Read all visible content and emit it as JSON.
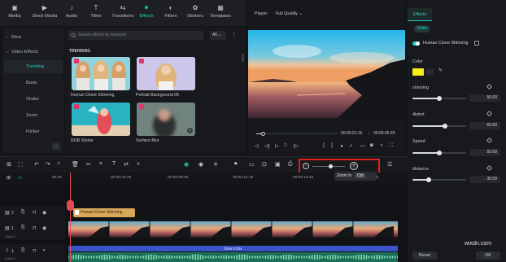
{
  "top_tabs": [
    {
      "label": "Media",
      "icon": "media-icon"
    },
    {
      "label": "Stock Media",
      "icon": "stock-media-icon"
    },
    {
      "label": "Audio",
      "icon": "audio-icon"
    },
    {
      "label": "Titles",
      "icon": "titles-icon"
    },
    {
      "label": "Transitions",
      "icon": "transitions-icon"
    },
    {
      "label": "Effects",
      "icon": "effects-icon",
      "active": true
    },
    {
      "label": "Filters",
      "icon": "filters-icon"
    },
    {
      "label": "Stickers",
      "icon": "stickers-icon"
    },
    {
      "label": "Templates",
      "icon": "templates-icon"
    }
  ],
  "sidebar": {
    "items": [
      {
        "label": "Mine"
      },
      {
        "label": "Video Effects"
      },
      {
        "label": "Trending"
      },
      {
        "label": "Basic"
      },
      {
        "label": "Shake"
      },
      {
        "label": "Zoom"
      },
      {
        "label": "Flicker"
      }
    ]
  },
  "library": {
    "search_placeholder": "Search effects by keyword",
    "filter": "All",
    "section": "TRENDING",
    "cards": [
      {
        "label": "Human Clone Shinning"
      },
      {
        "label": "Portrait Background 05"
      },
      {
        "label": "RGB Stroke"
      },
      {
        "label": "Surface Blur"
      }
    ]
  },
  "player": {
    "label": "Player",
    "quality": "Full Quality",
    "current_time": "00:00:01:16",
    "total_time": "00:00:05:20",
    "progress": 0.08
  },
  "effects_panel": {
    "tab": "Effects",
    "video_pill": "Video",
    "effect_name": "Human Clone Shinning",
    "color_label": "Color",
    "color_value": "#f5f017",
    "params": [
      {
        "label": "shinning",
        "value": "50.00",
        "fraction": 0.5
      },
      {
        "label": "distort",
        "value": "60.00",
        "fraction": 0.6
      },
      {
        "label": "Speed",
        "value": "50.00",
        "fraction": 0.5
      },
      {
        "label": "distance",
        "value": "30.00",
        "fraction": 0.3
      }
    ],
    "reset_label": "Reset",
    "ok_label": "OK"
  },
  "timeline": {
    "ruler_labels": [
      "00:00",
      "00:00:04:25",
      "00:00:09:20",
      "00:00:14:15",
      "00:00:19:10",
      "00:00:24:05"
    ],
    "effect_clip": "Human Clone Shinning",
    "audio_clip": "Slow 0.50x",
    "video_track_label": "Video 1",
    "audio_track_label": "Audio 1",
    "track_numbers": [
      "2",
      "1",
      "1"
    ],
    "zoom_tooltip": "Zoom In",
    "zoom_shortcut": "Ctrl"
  },
  "watermark": "wixdn.com"
}
